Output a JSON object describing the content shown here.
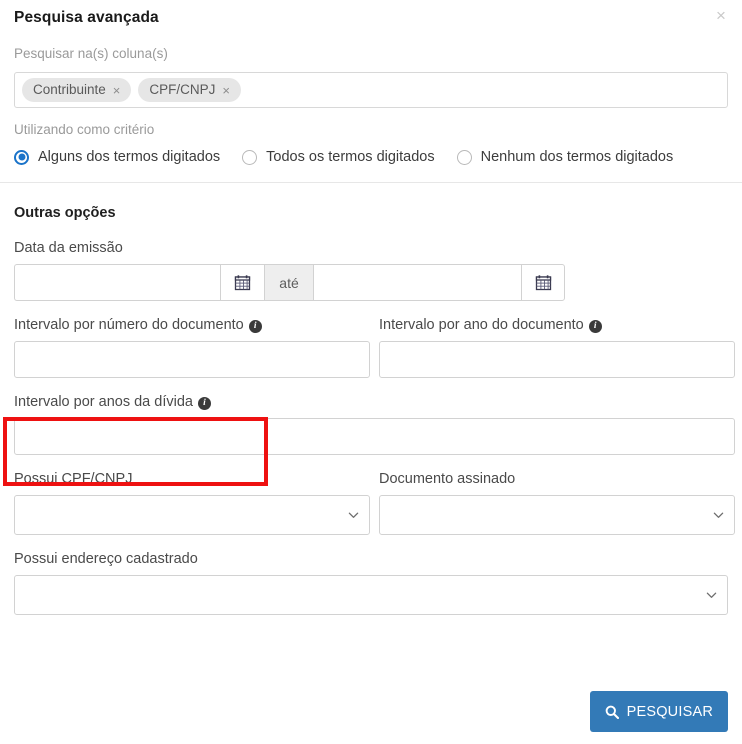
{
  "header": {
    "title": "Pesquisa avançada",
    "close_label": "×"
  },
  "search_columns": {
    "label": "Pesquisar na(s) coluna(s)",
    "tokens": [
      {
        "label": "Contribuinte",
        "remove": "×"
      },
      {
        "label": "CPF/CNPJ",
        "remove": "×"
      }
    ]
  },
  "criteria": {
    "label": "Utilizando como critério",
    "options": [
      {
        "label": "Alguns dos termos digitados",
        "selected": true
      },
      {
        "label": "Todos os termos digitados",
        "selected": false
      },
      {
        "label": "Nenhum dos termos digitados",
        "selected": false
      }
    ]
  },
  "other_options": {
    "title": "Outras opções",
    "issue_date": {
      "label": "Data da emissão",
      "from_value": "",
      "to_value": "",
      "separator": "até",
      "calendar_icon": "calendar-icon"
    },
    "doc_number_range": {
      "label": "Intervalo por número do documento",
      "info_icon": "info-icon",
      "value": ""
    },
    "doc_year_range": {
      "label": "Intervalo por ano do documento",
      "info_icon": "info-icon",
      "value": ""
    },
    "debt_years_range": {
      "label": "Intervalo por anos da dívida",
      "info_icon": "info-icon",
      "value": ""
    },
    "has_cpf_cnpj": {
      "label": "Possui CPF/CNPJ",
      "value": "",
      "options": [
        ""
      ]
    },
    "signed_document": {
      "label": "Documento assinado",
      "value": "",
      "options": [
        ""
      ]
    },
    "has_address": {
      "label": "Possui endereço cadastrado",
      "value": "",
      "options": [
        ""
      ]
    }
  },
  "footer": {
    "search_button": "PESQUISAR",
    "search_icon": "magnifier-icon"
  },
  "colors": {
    "primary": "#337ab7",
    "radio_selected": "#1a73c9",
    "annotation": "#ee1111",
    "token_bg": "#e6e6e6"
  }
}
